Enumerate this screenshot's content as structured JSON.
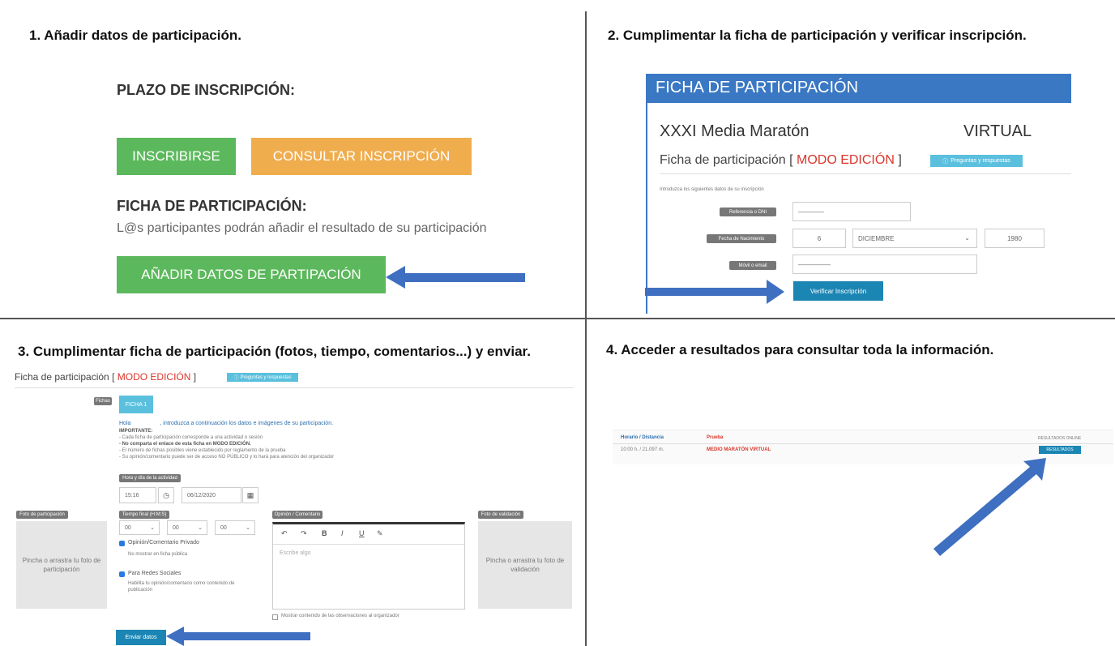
{
  "steps": {
    "s1": "1. Añadir datos de participación.",
    "s2": "2. Cumplimentar la ficha de participación y verificar inscripción.",
    "s3": "3. Cumplimentar ficha de participación (fotos, tiempo, comentarios...) y enviar.",
    "s4": "4. Acceder a resultados para consultar toda la información."
  },
  "panel1": {
    "plazo": "PLAZO DE INSCRIPCIÓN:",
    "inscribirse": "INSCRIBIRSE",
    "consultar": "CONSULTAR INSCRIPCIÓN",
    "ficha_heading": "FICHA DE PARTICIPACIÓN:",
    "ficha_desc": "L@s participantes podrán añadir el resultado de su participación",
    "anadir": "AÑADIR DATOS DE PARTIPACIÓN"
  },
  "panel2": {
    "header": "FICHA DE PARTICIPACIÓN",
    "event_name": "XXXI Media Maratón",
    "event_mode": "VIRTUAL",
    "ficha_prefix": "Ficha de participación [ ",
    "modo": "MODO EDICIÓN",
    "ficha_suffix": " ]",
    "faq": "Preguntas y respuestas",
    "intro": "Introduzca los siguientes datos de su inscripción",
    "ref_label": "Referencia o DNI",
    "ref_value": "————",
    "dob_label": "Fecha de Nacimiento",
    "day": "6",
    "month": "DICIEMBRE",
    "year": "1980",
    "movil_label": "Móvil o email",
    "movil_value": "—————",
    "verify": "Verificar Inscripción"
  },
  "panel3": {
    "ficha_prefix": "Ficha de participación [ ",
    "modo": "MODO EDICIÓN",
    "ficha_suffix": " ]",
    "faq": "Preguntas y respuestas",
    "fichas_label": "Fichas",
    "ficha_tab": "FICHA 1",
    "hola": "Hola",
    "hola_rest": ", introduzca a continuación los datos e imágenes de su participación.",
    "importante": "IMPORTANTE:",
    "notes": [
      "- Cada ficha de participación corresponde a una actividad o sesión",
      "- No comparta el enlace de esta ficha en MODO EDICIÓN.",
      "- El número de fichas posibles viene establecido por reglamento de la prueba",
      "- Su opinión/comentario puede ser de acceso NO PÚBLICO y lo hará para atención del organizador"
    ],
    "fecha_label": "Hora y día de la actividad",
    "hora": "15:16",
    "fecha": "06/12/2020",
    "foto_part_label": "Foto de participación",
    "foto_part_drop": "Pincha o arrastra tu foto de participación",
    "tiempo_label": "Tiempo final (H:M:S)",
    "t1": "00",
    "t2": "00",
    "t3": "00",
    "opinion_label": "Opinión / Comentario",
    "editor_placeholder": "Escribe algo",
    "chk1": "Opinión/Comentario Privado",
    "chk1_desc": "No mostrar en ficha pública",
    "chk2": "Para Redes Sociales",
    "chk2_desc": "Habilita tu opinión/comentario como contenido de publicación",
    "mostrar": "Mostrar contenido de las observaciones al organizador",
    "foto_val_label": "Foto de validación",
    "foto_val_drop": "Pincha o arrastra tu foto de validación",
    "enviar": "Enviar datos"
  },
  "panel4": {
    "col1": "Horario / Distancia",
    "col2": "Prueba",
    "col3": "RESULTADOS ONLINE",
    "row_time": "10:00 h. / 21.097 m.",
    "row_name": "MEDIO MARATÓN VIRTUAL",
    "row_btn": "RESULTADOS"
  },
  "colors": {
    "green": "#5cb85c",
    "orange": "#f0ad4e",
    "blue_header": "#3a78c3",
    "teal_button": "#1b86b4",
    "red": "#d9362b",
    "arrow": "#3f6fc0"
  }
}
